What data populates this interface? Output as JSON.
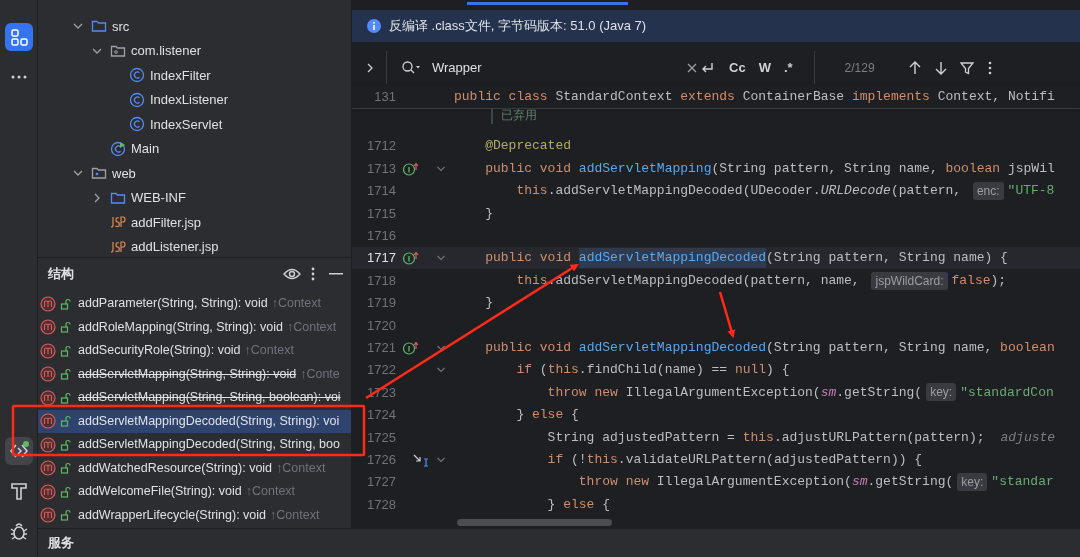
{
  "activity_bar": {
    "top": [
      {
        "kind": "project",
        "selected": true
      },
      {
        "kind": "more",
        "selected": false
      }
    ],
    "bottom": [
      {
        "kind": "structure",
        "selected": true
      },
      {
        "kind": "build",
        "selected": false
      },
      {
        "kind": "debug",
        "selected": false
      }
    ]
  },
  "project_tree": [
    {
      "label": "src",
      "kind": "folder",
      "expanded": true,
      "children": [
        {
          "label": "com.listener",
          "kind": "package",
          "expanded": true,
          "children": [
            {
              "label": "IndexFilter",
              "kind": "class"
            },
            {
              "label": "IndexListener",
              "kind": "class"
            },
            {
              "label": "IndexServlet",
              "kind": "class"
            }
          ]
        },
        {
          "label": "Main",
          "kind": "main-class"
        }
      ]
    },
    {
      "label": "web",
      "kind": "web-folder",
      "expanded": true,
      "children": [
        {
          "label": "WEB-INF",
          "kind": "folder",
          "expanded": false
        },
        {
          "label": "addFilter.jsp",
          "kind": "jsp"
        },
        {
          "label": "addListener.jsp",
          "kind": "jsp"
        }
      ]
    }
  ],
  "structure": {
    "title": "结构",
    "items": [
      {
        "signature": "addParameter(String, String): void",
        "origin": "↑Context",
        "deprecated": false,
        "selected": false
      },
      {
        "signature": "addRoleMapping(String, String): void",
        "origin": "↑Context",
        "deprecated": false,
        "selected": false
      },
      {
        "signature": "addSecurityRole(String): void",
        "origin": "↑Context",
        "deprecated": false,
        "selected": false
      },
      {
        "signature": "addServletMapping(String, String): void",
        "origin": "↑Conte",
        "deprecated": true,
        "selected": false
      },
      {
        "signature": "addServletMapping(String, String, boolean): voi",
        "deprecated": true,
        "selected": false
      },
      {
        "signature": "addServletMappingDecoded(String, String): voi",
        "deprecated": false,
        "selected": true
      },
      {
        "signature": "addServletMappingDecoded(String, String, boo",
        "deprecated": false,
        "selected": false
      },
      {
        "signature": "addWatchedResource(String): void",
        "origin": "↑Context",
        "deprecated": false,
        "selected": false
      },
      {
        "signature": "addWelcomeFile(String): void",
        "origin": "↑Context",
        "deprecated": false,
        "selected": false
      },
      {
        "signature": "addWrapperLifecycle(String): void",
        "origin": "↑Context",
        "deprecated": false,
        "selected": false
      }
    ]
  },
  "services": {
    "title": "服务"
  },
  "banner": {
    "text": "反编译 .class文件, 字节码版本: 51.0 (Java 7)"
  },
  "search": {
    "value": "Wrapper",
    "options": [
      "Cc",
      "W",
      ".*"
    ],
    "count": "2/129"
  },
  "editor": {
    "sticky": {
      "number": "131",
      "tokens": [
        {
          "kind": "keyword",
          "text": "public class "
        },
        {
          "kind": "plain",
          "text": "StandardContext "
        },
        {
          "kind": "keyword",
          "text": "extends "
        },
        {
          "kind": "plain",
          "text": "ContainerBase "
        },
        {
          "kind": "keyword",
          "text": "implements "
        },
        {
          "kind": "plain",
          "text": "Context, Notifi"
        }
      ]
    },
    "doc": "已弃用",
    "lines": [
      {
        "number": "1712",
        "current": false,
        "foldable": false,
        "tokens": [
          {
            "kind": "annotation",
            "text": "    @Deprecated"
          }
        ]
      },
      {
        "number": "1713",
        "current": false,
        "foldable": true,
        "kind": "override",
        "tokens": [
          {
            "kind": "keyword",
            "text": "    public void "
          },
          {
            "kind": "method",
            "text": "addServletMapping"
          },
          {
            "kind": "plain",
            "text": "(String pattern, String name, "
          },
          {
            "kind": "keyword",
            "text": "boolean "
          },
          {
            "kind": "plain",
            "text": "jspWil"
          }
        ]
      },
      {
        "number": "1714",
        "current": false,
        "foldable": false,
        "tokens": [
          {
            "kind": "keyword",
            "text": "        this"
          },
          {
            "kind": "plain",
            "text": ".addServletMappingDecoded(UDecoder."
          },
          {
            "kind": "static",
            "text": "URLDecode"
          },
          {
            "kind": "plain",
            "text": "(pattern, "
          },
          {
            "kind": "hint",
            "text": "enc:"
          },
          {
            "kind": "string",
            "text": "\"UTF-8"
          }
        ]
      },
      {
        "number": "1715",
        "current": false,
        "foldable": false,
        "tokens": [
          {
            "kind": "plain",
            "text": "    }"
          }
        ]
      },
      {
        "number": "1716",
        "current": false,
        "foldable": false
      },
      {
        "number": "1717",
        "current": true,
        "foldable": true,
        "kind": "override",
        "tokens": [
          {
            "kind": "keyword",
            "text": "    public void "
          },
          {
            "kind": "match",
            "text": "addServletMappingDecoded"
          },
          {
            "kind": "plain",
            "text": "(String pattern, String name) {"
          }
        ]
      },
      {
        "number": "1718",
        "current": false,
        "foldable": false,
        "tokens": [
          {
            "kind": "keyword",
            "text": "        this"
          },
          {
            "kind": "plain",
            "text": ".addServletMappingDecoded(pattern, name, "
          },
          {
            "kind": "hint",
            "text": "jspWildCard:"
          },
          {
            "kind": "keyword",
            "text": "false"
          },
          {
            "kind": "plain",
            "text": ");"
          }
        ]
      },
      {
        "number": "1719",
        "current": false,
        "foldable": false,
        "tokens": [
          {
            "kind": "plain",
            "text": "    }"
          }
        ]
      },
      {
        "number": "1720",
        "current": false,
        "foldable": false
      },
      {
        "number": "1721",
        "current": false,
        "foldable": true,
        "kind": "override",
        "tokens": [
          {
            "kind": "keyword",
            "text": "    public void "
          },
          {
            "kind": "method",
            "text": "addServletMappingDecoded"
          },
          {
            "kind": "plain",
            "text": "(String pattern, String name, "
          },
          {
            "kind": "keyword",
            "text": "boolean"
          }
        ]
      },
      {
        "number": "1722",
        "current": false,
        "foldable": true,
        "tokens": [
          {
            "kind": "keyword",
            "text": "        if "
          },
          {
            "kind": "plain",
            "text": "("
          },
          {
            "kind": "keyword",
            "text": "this"
          },
          {
            "kind": "plain",
            "text": ".findChild(name) == "
          },
          {
            "kind": "keyword",
            "text": "null"
          },
          {
            "kind": "plain",
            "text": ") {"
          }
        ]
      },
      {
        "number": "1723",
        "current": false,
        "foldable": false,
        "tokens": [
          {
            "kind": "keyword",
            "text": "            throw new "
          },
          {
            "kind": "plain",
            "text": "IllegalArgumentException("
          },
          {
            "kind": "field",
            "text": "sm"
          },
          {
            "kind": "plain",
            "text": ".getString("
          },
          {
            "kind": "hint",
            "text": "key:"
          },
          {
            "kind": "string",
            "text": "\"standardCon"
          }
        ]
      },
      {
        "number": "1724",
        "current": false,
        "foldable": false,
        "tokens": [
          {
            "kind": "plain",
            "text": "        } "
          },
          {
            "kind": "keyword",
            "text": "else "
          },
          {
            "kind": "plain",
            "text": "{"
          }
        ]
      },
      {
        "number": "1725",
        "current": false,
        "foldable": false,
        "tokens": [
          {
            "kind": "plain",
            "text": "            String adjustedPattern = "
          },
          {
            "kind": "keyword",
            "text": "this"
          },
          {
            "kind": "plain",
            "text": ".adjustURLPattern(pattern);"
          },
          {
            "kind": "value-hint",
            "text": "adjuste"
          }
        ]
      },
      {
        "number": "1726",
        "current": false,
        "foldable": true,
        "kind": "step",
        "tokens": [
          {
            "kind": "keyword",
            "text": "            if "
          },
          {
            "kind": "plain",
            "text": "(!"
          },
          {
            "kind": "keyword",
            "text": "this"
          },
          {
            "kind": "plain",
            "text": ".validateURLPattern(adjustedPattern)) {"
          }
        ]
      },
      {
        "number": "1727",
        "current": false,
        "foldable": false,
        "tokens": [
          {
            "kind": "keyword",
            "text": "                throw new "
          },
          {
            "kind": "plain",
            "text": "IllegalArgumentException("
          },
          {
            "kind": "field",
            "text": "sm"
          },
          {
            "kind": "plain",
            "text": ".getString("
          },
          {
            "kind": "hint",
            "text": "key:"
          },
          {
            "kind": "string",
            "text": "\"standar"
          }
        ]
      },
      {
        "number": "1728",
        "current": false,
        "foldable": false,
        "tokens": [
          {
            "kind": "plain",
            "text": "            } "
          },
          {
            "kind": "keyword",
            "text": "else "
          },
          {
            "kind": "plain",
            "text": "{"
          }
        ]
      }
    ]
  }
}
